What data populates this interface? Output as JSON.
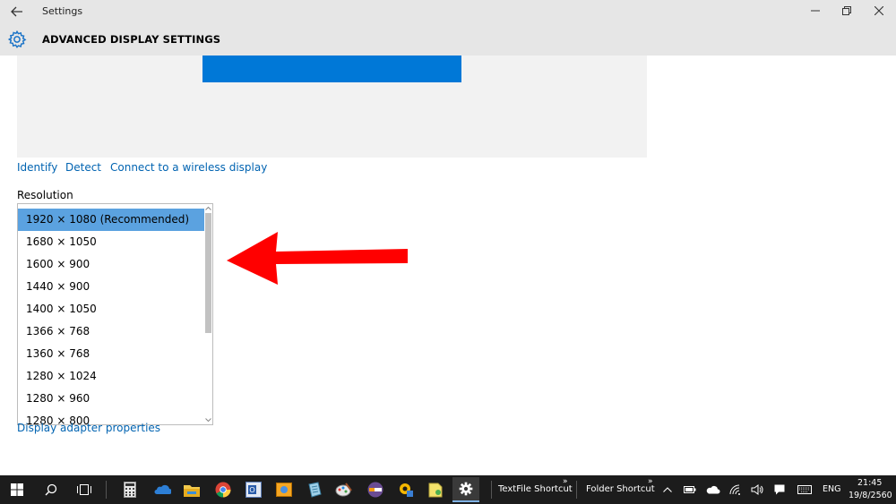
{
  "window": {
    "app_title": "Settings",
    "page_title": "ADVANCED DISPLAY SETTINGS"
  },
  "links": {
    "identify": "Identify",
    "detect": "Detect",
    "wireless": "Connect to a wireless display",
    "adapter": "Display adapter properties"
  },
  "resolution": {
    "label": "Resolution",
    "selected": "1920 × 1080 (Recommended)",
    "options": [
      "1920 × 1080 (Recommended)",
      "1680 × 1050",
      "1600 × 900",
      "1440 × 900",
      "1400 × 1050",
      "1366 × 768",
      "1360 × 768",
      "1280 × 1024",
      "1280 × 960",
      "1280 × 800"
    ]
  },
  "colors": {
    "accent": "#0078d7",
    "selection": "#5ba2e0",
    "link": "#0063b1",
    "annotation_arrow": "#ff0000",
    "taskbar": "#1c1c1c"
  },
  "taskbar": {
    "pinned": [
      "windows-start-icon",
      "search-icon",
      "task-view-icon",
      "calculator-icon",
      "onedrive-icon",
      "file-explorer-icon",
      "chrome-icon",
      "outlook-icon",
      "photo-viewer-icon",
      "notepad-icon",
      "paint-icon",
      "media-player-icon",
      "setup-icon",
      "sticky-notes-icon",
      "settings-gear-icon"
    ],
    "toolbar1": "TextFile Shortcut",
    "toolbar2": "Folder Shortcut",
    "language": "ENG",
    "time": "21:45",
    "date": "19/8/2560"
  }
}
